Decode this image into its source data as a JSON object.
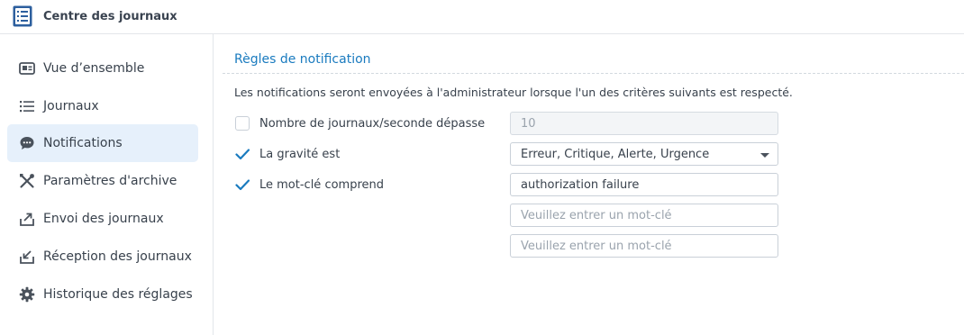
{
  "app": {
    "title": "Centre des journaux",
    "icon": "log-center-icon"
  },
  "sidebar": {
    "items": [
      {
        "label": "Vue d’ensemble",
        "icon": "overview-card-icon",
        "active": false
      },
      {
        "label": "Journaux",
        "icon": "list-icon",
        "active": false
      },
      {
        "label": "Notifications",
        "icon": "chat-bubble-icon",
        "active": true
      },
      {
        "label": "Paramètres d'archive",
        "icon": "tools-icon",
        "active": false
      },
      {
        "label": "Envoi des journaux",
        "icon": "send-arrow-icon",
        "active": false
      },
      {
        "label": "Réception des journaux",
        "icon": "receive-tray-icon",
        "active": false
      },
      {
        "label": "Historique des réglages",
        "icon": "gear-icon",
        "active": false
      }
    ]
  },
  "main": {
    "section_title": "Règles de notification",
    "description": "Les notifications seront envoyées à l'administrateur lorsque l'un des critères suivants est respecté.",
    "rules": [
      {
        "label": "Nombre de journaux/seconde dépasse",
        "checked": false,
        "value": "10",
        "disabled": true
      },
      {
        "label": "La gravité est",
        "checked": true,
        "value": "Erreur, Critique, Alerte, Urgence",
        "type": "select"
      },
      {
        "label": "Le mot-clé comprend",
        "checked": true,
        "value": "authorization failure"
      }
    ],
    "keyword_placeholder": "Veuillez entrer un mot-clé"
  },
  "colors": {
    "accent": "#1a7bbf",
    "active_bg": "#e6f0fb",
    "checkbox": "#1a7bbf"
  }
}
